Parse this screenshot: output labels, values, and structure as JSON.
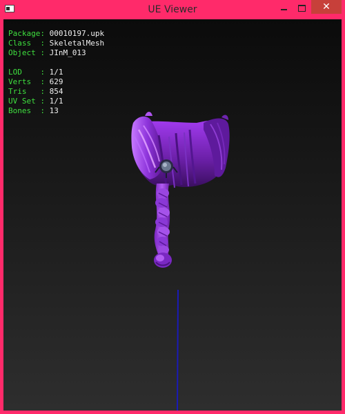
{
  "window": {
    "title": "UE Viewer",
    "close_label": "✕"
  },
  "info_block_1": [
    {
      "key": "Package",
      "sep": ": ",
      "value": "00010197.upk"
    },
    {
      "key": "Class  ",
      "sep": ": ",
      "value": "SkeletalMesh"
    },
    {
      "key": "Object ",
      "sep": ": ",
      "value": "JInM_013"
    }
  ],
  "info_block_2": [
    {
      "key": "LOD    ",
      "sep": ": ",
      "value": "1/1"
    },
    {
      "key": "Verts  ",
      "sep": ": ",
      "value": "629"
    },
    {
      "key": "Tris   ",
      "sep": ": ",
      "value": "854"
    },
    {
      "key": "UV Set ",
      "sep": ": ",
      "value": "1/1"
    },
    {
      "key": "Bones  ",
      "sep": ": ",
      "value": "13"
    }
  ],
  "colors": {
    "frame": "#ff2a6a",
    "label": "#3fe03f",
    "value": "#f0f0f0",
    "hair": "#8a2fd0",
    "axis": "#1a1ab8"
  }
}
